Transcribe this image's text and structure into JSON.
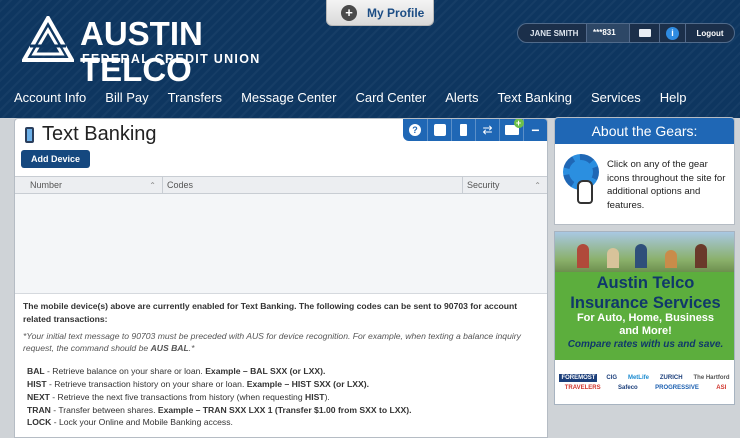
{
  "brand": {
    "name": "AUSTIN TELCO",
    "subtitle": "FEDERAL CREDIT UNION"
  },
  "profile_tab": {
    "label": "My Profile"
  },
  "userbar": {
    "name": "JANE SMITH",
    "account": "***831",
    "logout": "Logout"
  },
  "nav": [
    "Account Info",
    "Bill Pay",
    "Transfers",
    "Message Center",
    "Card Center",
    "Alerts",
    "Text Banking",
    "Services",
    "Help"
  ],
  "panel": {
    "title": "Text Banking",
    "add_device": "Add Device",
    "columns": [
      "Number",
      "Codes",
      "Security"
    ]
  },
  "info": {
    "intro": "The mobile device(s) above are currently enabled for Text Banking. The following codes can be sent to 90703 for account related transactions:",
    "note_a": "*Your initial text message to 90703 must be preceded with AUS for device recognition. For example, when texting a balance inquiry request, the command should be ",
    "note_b": "AUS BAL",
    "note_c": ".*",
    "cmds": [
      {
        "code": "BAL",
        "desc": " - Retrieve balance on your share or loan. ",
        "example": "Example – BAL SXX (or LXX)."
      },
      {
        "code": "HIST",
        "desc": " - Retrieve transaction history on your share or loan. ",
        "example": "Example – HIST SXX (or LXX)."
      },
      {
        "code": "NEXT",
        "desc": " - Retrieve the next five transactions from history (when requesting ",
        "example": "HIST",
        "tail": ")."
      },
      {
        "code": "TRAN",
        "desc": " - Transfer between shares. ",
        "example": "Example – TRAN SXX LXX 1 (Transfer $1.00 from SXX to LXX)."
      },
      {
        "code": "LOCK",
        "desc": " - Lock your Online and Mobile Banking access.",
        "example": ""
      }
    ]
  },
  "gears": {
    "title": "About the Gears:",
    "text": "Click on any of the gear icons throughout the site for additional options and features."
  },
  "ad": {
    "line1a": "Austin Telco",
    "line1b": "Insurance Services",
    "line2a": "For Auto, Home, Business",
    "line2b": "and More!",
    "line3": "Compare rates with us and save.",
    "logos": [
      "FOREMOST",
      "CIG",
      "MetLife",
      "ZURICH",
      "The Hartford",
      "TRAVELERS",
      "Safeco",
      "PROGRESSIVE",
      "ASI"
    ]
  },
  "colors": {
    "header_bg": "#0e3660",
    "accent": "#1f67b5",
    "button": "#15487f",
    "ad_green": "#5cae3d"
  }
}
